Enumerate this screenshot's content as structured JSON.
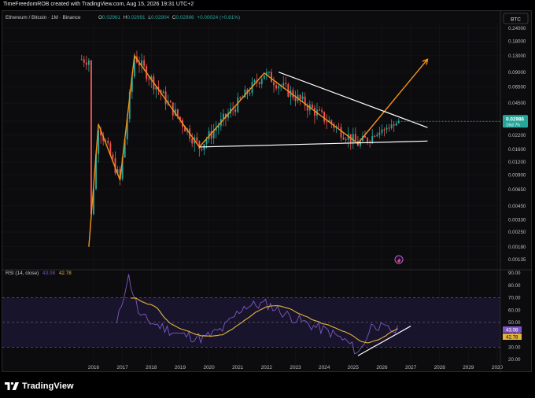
{
  "header": {
    "text": "TimeFreedomROB created with TradingView.com, Aug 15, 2026 19:31 UTC+2"
  },
  "footer": {
    "logo_text": "TradingView"
  },
  "chart_data": {
    "type": "candlestick",
    "symbol_line": {
      "name": "Ethereum / Bitcoin · 1M · Binance",
      "open_label": "O",
      "open": "0.02961",
      "high_label": "H",
      "high": "0.02991",
      "low_label": "L",
      "low": "0.02904",
      "close_label": "C",
      "close": "0.02986",
      "change": "+0.00024 (+0.81%)"
    },
    "price_axis": {
      "currency": "BTC",
      "scale": "log",
      "ticks": [
        "0.24000",
        "0.18000",
        "0.13000",
        "0.09000",
        "0.06500",
        "0.04500",
        "0.03000",
        "0.02200",
        "0.01600",
        "0.01200",
        "0.00900",
        "0.00650",
        "0.00450",
        "0.00330",
        "0.00250",
        "0.00180",
        "0.00135"
      ],
      "current_price": "0.02986",
      "countdown": "16d 7h"
    },
    "time_axis": {
      "ticks": [
        "2016",
        "2017",
        "2018",
        "2019",
        "2020",
        "2021",
        "2022",
        "2023",
        "2024",
        "2025",
        "2026",
        "2027",
        "2028",
        "2029",
        "2030"
      ]
    },
    "candles_range": [
      "2015-08",
      "2026-08"
    ],
    "swing_path": [
      [
        "2015-11",
        0.0018
      ],
      [
        "2016-03",
        0.028
      ],
      [
        "2016-12",
        0.008
      ],
      [
        "2017-06",
        0.13
      ],
      [
        "2019-09",
        0.0168
      ],
      [
        "2021-12",
        0.088
      ],
      [
        "2025-03",
        0.0182
      ],
      [
        "2027-08",
        0.12
      ]
    ],
    "trendlines": [
      {
        "name": "descending-resistance",
        "points": [
          [
            "2022-06",
            0.09
          ],
          [
            "2027-08",
            0.026
          ]
        ]
      },
      {
        "name": "rising-support",
        "points": [
          [
            "2019-09",
            0.0168
          ],
          [
            "2027-08",
            0.0192
          ]
        ]
      }
    ],
    "rsi_panel": {
      "label": "RSI (14, close)",
      "value": "43.08",
      "ma_value": "42.78",
      "ticks": [
        "90.00",
        "80.00",
        "70.00",
        "60.00",
        "50.00",
        "40.00",
        "30.00",
        "20.00"
      ],
      "upper_band": 70,
      "middle_band": 50,
      "lower_band": 30,
      "trendline": [
        [
          "2025-03",
          23
        ],
        [
          "2027-01",
          47
        ]
      ]
    },
    "colors": {
      "swing": "#f7931a",
      "up_candle": "#26a69a",
      "down_candle": "#ef5350",
      "rsi_line": "#7e57c2",
      "rsi_ma": "#e5b53b",
      "trendline": "#ffffff",
      "price_label": "#26a69a"
    }
  }
}
